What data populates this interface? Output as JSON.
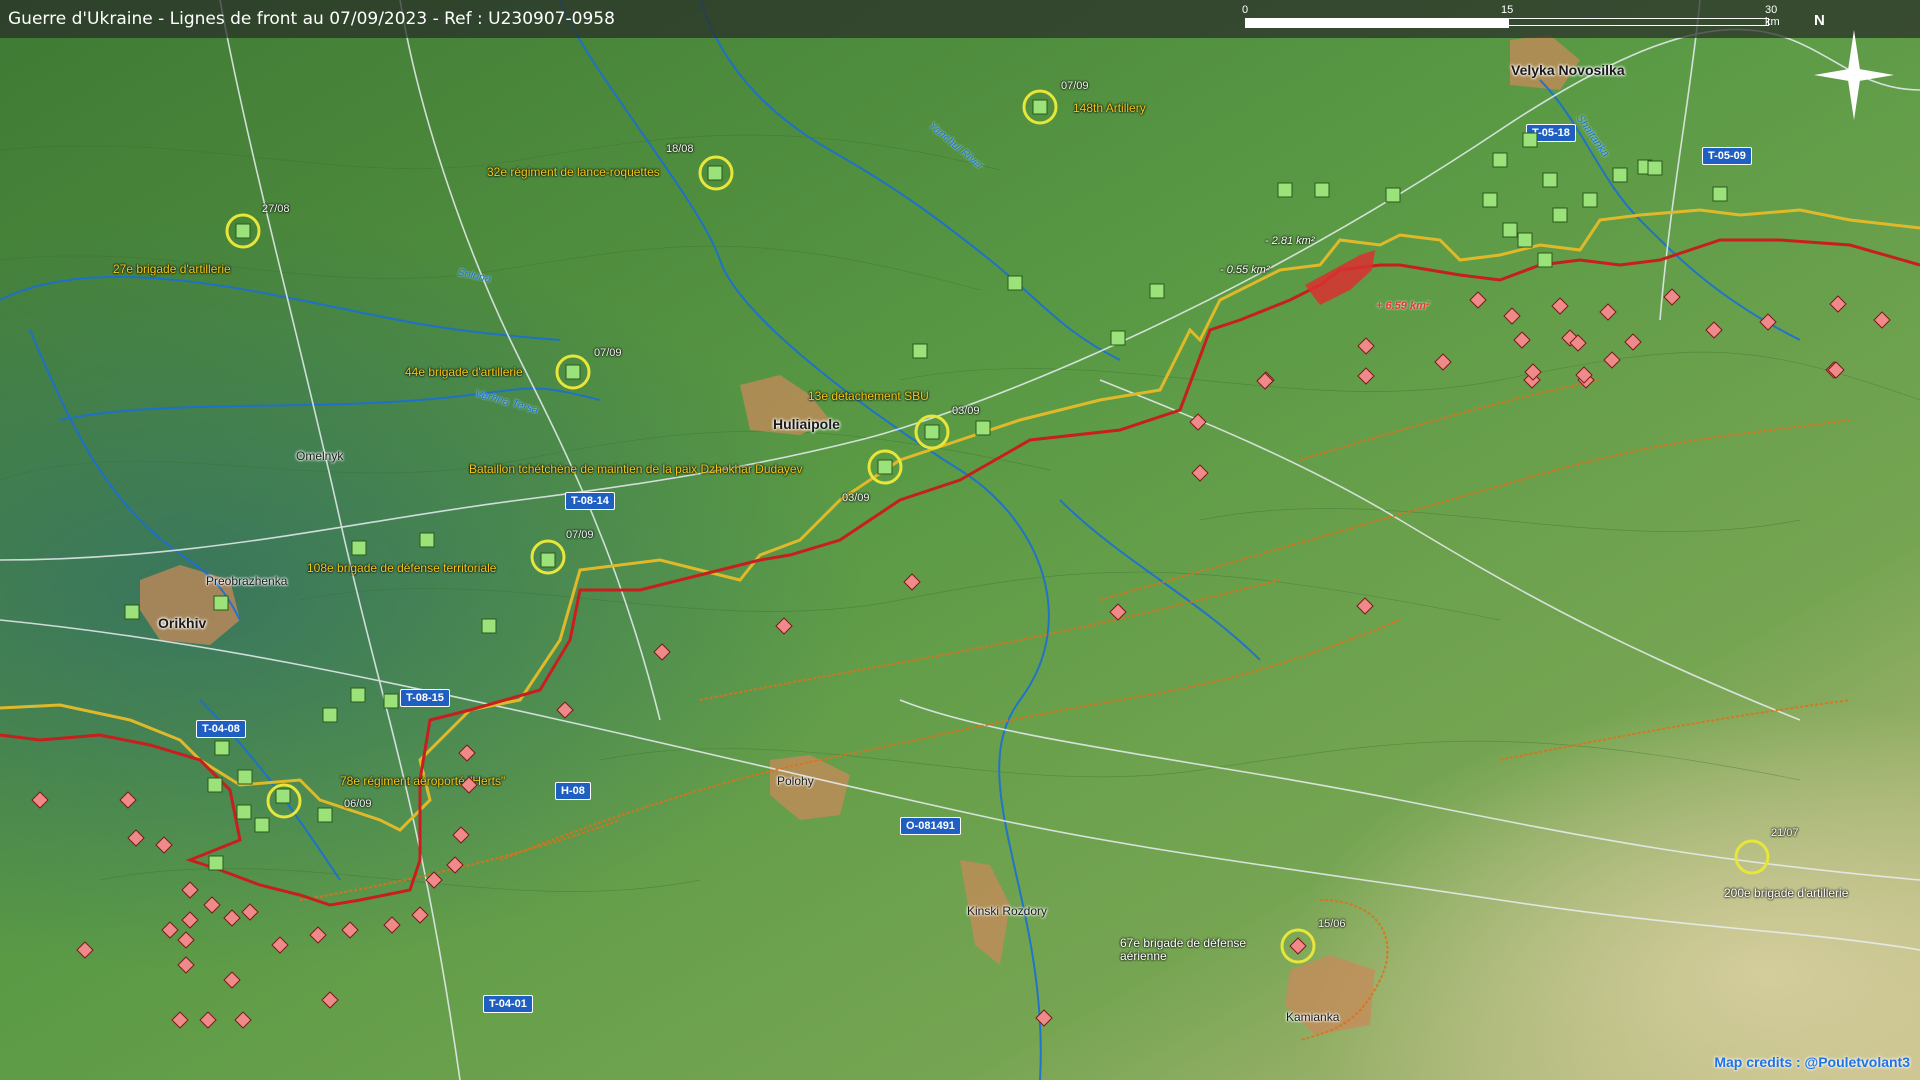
{
  "title": "Guerre d'Ukraine - Lignes de front au 07/09/2023 - Ref : U230907-0958",
  "scale": {
    "t0": "0",
    "t1": "15",
    "t2": "30 km"
  },
  "north": "N",
  "credits": "Map credits : @Pouletvolant3",
  "colors": {
    "front_line_ru": "#c81e1e",
    "front_line_ua": "#e0b92a",
    "ukr_unit": "#9be27a",
    "rus_unit": "#f08a8a",
    "river": "#1a6fd6",
    "road": "#1f5fc2"
  },
  "towns": {
    "velyka": "Velyka Novosilka",
    "huliaipole": "Huliaipole",
    "omelnyk": "Omelnyk",
    "preobrazhenka": "Preobrazhenka",
    "orikhiv": "Orikhiv",
    "polohy": "Polohy",
    "kinski": "Kinski Rozdory",
    "kamianka": "Kamianka"
  },
  "rivers": {
    "yanchul": "Yanchul River",
    "shaitanka": "Shaitanka",
    "solona": "Solona",
    "verhna": "Verhna Tersa"
  },
  "roads": {
    "t0518": "T-05-18",
    "t0509": "T-05-09",
    "t0814": "T-08-14",
    "t0815": "T-08-15",
    "t0408": "T-04-08",
    "h08": "H-08",
    "o081491": "O-081491",
    "t0401": "T-04-01"
  },
  "units": {
    "u148": "148th Artillery",
    "d148": "07/09",
    "u32": "32e régiment de lance-roquettes",
    "d32": "18/08",
    "u27": "27e brigade d'artillerie",
    "d27": "27/08",
    "u44": "44e brigade d'artillerie",
    "d44": "07/09",
    "u13": "13e détachement SBU",
    "d13": "03/09",
    "ubat": "Bataillon tchétchène de maintien de la paix Dzhokhar Dudayev",
    "dbat": "03/09",
    "u108": "108e brigade de défense territoriale",
    "d108": "07/09",
    "u78": "78e régiment aéroporté \"Herts\"",
    "d78": "06/09",
    "u200": "200e brigade d'artillerie",
    "d200": "21/07",
    "u67": "67e brigade de défense aérienne",
    "d67": "15/06"
  },
  "areas": {
    "a1": "- 2.81 km²",
    "a2": "- 0.55 km²",
    "a3": "+ 6.59 km²"
  }
}
